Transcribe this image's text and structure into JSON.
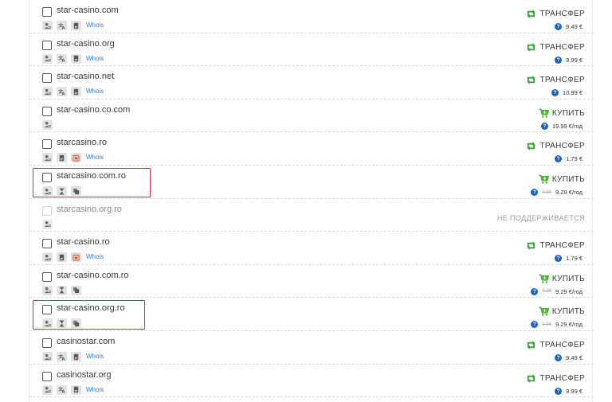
{
  "colors": {
    "transfer": "#3aa23a",
    "buy": "#47b52f",
    "whois_link": "#2f7fd1",
    "help_icon": "#1f61c2",
    "highlight": "#d3333e"
  },
  "domains": [
    {
      "name": "star-casino.com",
      "badges": [
        "user-icon",
        "translate-icon",
        "document-icon"
      ],
      "whois": "Whois",
      "action": "ТРАНСФЕР",
      "action_type": "transfer",
      "price": "9.49 €",
      "old_price": "",
      "enabled": true
    },
    {
      "name": "star-casino.org",
      "badges": [
        "user-icon",
        "translate-icon",
        "document-icon"
      ],
      "whois": "Whois",
      "action": "ТРАНСФЕР",
      "action_type": "transfer",
      "price": "9.99 €",
      "old_price": "",
      "enabled": true
    },
    {
      "name": "star-casino.net",
      "badges": [
        "user-icon",
        "translate-icon",
        "document-icon"
      ],
      "whois": "Whois",
      "action": "ТРАНСФЕР",
      "action_type": "transfer",
      "price": "10.99 €",
      "old_price": "",
      "enabled": true
    },
    {
      "name": "star-casino.co.com",
      "badges": [
        "user-icon"
      ],
      "whois": "",
      "action": "КУПИТЬ",
      "action_type": "buy",
      "price": "19.99 €/год",
      "old_price": "",
      "enabled": true
    },
    {
      "name": "starcasino.ro",
      "badges": [
        "user-icon",
        "document-icon",
        "calendar-icon"
      ],
      "whois": "Whois",
      "action": "ТРАНСФЕР",
      "action_type": "transfer",
      "price": "1.79 €",
      "old_price": "",
      "enabled": true
    },
    {
      "name": "starcasino.com.ro",
      "badges": [
        "user-icon",
        "hourglass-icon",
        "copy-icon"
      ],
      "whois": "",
      "action": "КУПИТЬ",
      "action_type": "buy",
      "price": "9.29 €/год",
      "old_price": "9.99",
      "enabled": true
    },
    {
      "name": "starcasino.org.ro",
      "badges": [
        "user-icon"
      ],
      "whois": "",
      "action": "НЕ ПОДДЕРЖИВАЕТСЯ",
      "action_type": "unsupported",
      "price": "",
      "old_price": "",
      "enabled": false
    },
    {
      "name": "star-casino.ro",
      "badges": [
        "user-icon",
        "document-icon",
        "calendar-icon"
      ],
      "whois": "Whois",
      "action": "ТРАНСФЕР",
      "action_type": "transfer",
      "price": "1.79 €",
      "old_price": "",
      "enabled": true
    },
    {
      "name": "star-casino.com.ro",
      "badges": [
        "user-icon",
        "hourglass-icon",
        "copy-icon"
      ],
      "whois": "",
      "action": "КУПИТЬ",
      "action_type": "buy",
      "price": "9.29 €/год",
      "old_price": "9.99",
      "enabled": true
    },
    {
      "name": "star-casino.org.ro",
      "badges": [
        "user-icon",
        "hourglass-icon",
        "copy-icon"
      ],
      "whois": "",
      "action": "КУПИТЬ",
      "action_type": "buy",
      "price": "9.29 €/год",
      "old_price": "9.99",
      "enabled": true
    },
    {
      "name": "casinostar.com",
      "badges": [
        "user-icon",
        "translate-icon",
        "document-icon"
      ],
      "whois": "Whois",
      "action": "ТРАНСФЕР",
      "action_type": "transfer",
      "price": "9.49 €",
      "old_price": "",
      "enabled": true
    },
    {
      "name": "casinostar.org",
      "badges": [
        "user-icon",
        "translate-icon",
        "document-icon"
      ],
      "whois": "Whois",
      "action": "ТРАНСФЕР",
      "action_type": "transfer",
      "price": "9.99 €",
      "old_price": "",
      "enabled": true
    }
  ],
  "highlighted_domains": [
    "starcasino.com.ro",
    "star-casino.org.ro"
  ]
}
